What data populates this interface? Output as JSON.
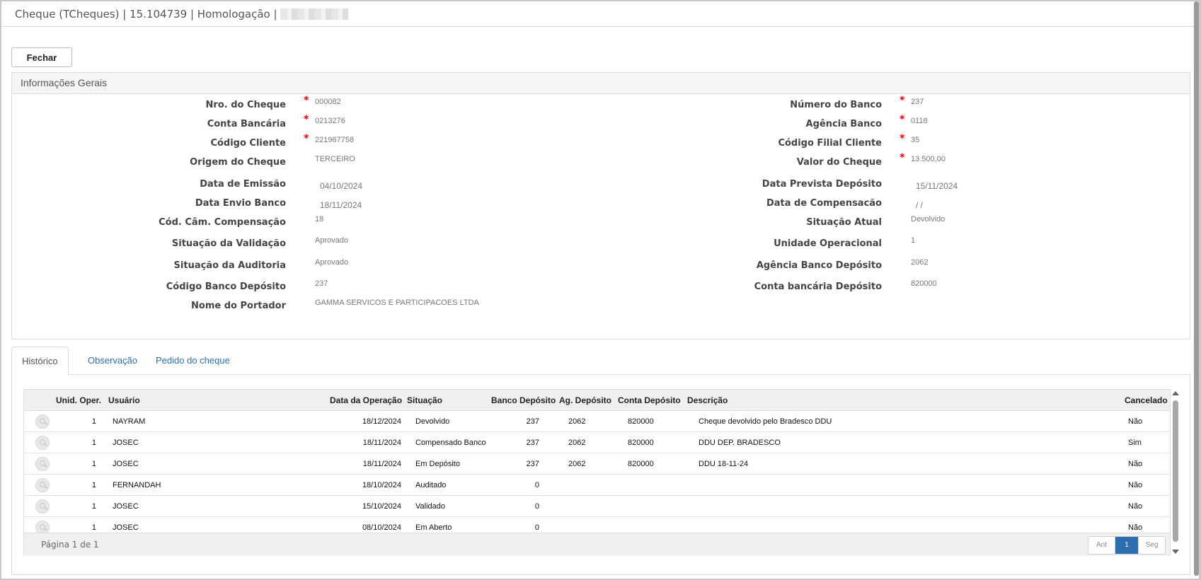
{
  "window": {
    "title": "Cheque (TCheques) | 15.104739 | Homologação |"
  },
  "toolbar": {
    "close_label": "Fechar"
  },
  "general": {
    "title": "Informações Gerais",
    "left": [
      {
        "label": "Nro. do Cheque",
        "value": "000082",
        "required": true
      },
      {
        "label": "Conta Bancária",
        "value": "0213276",
        "required": true
      },
      {
        "label": "Código Cliente",
        "value": "221967758",
        "required": true
      },
      {
        "label": "Origem do Cheque",
        "value": "TERCEIRO",
        "required": false
      },
      {
        "label": "Data de Emissão",
        "value": "04/10/2024",
        "required": false
      },
      {
        "label": "Data Envio Banco",
        "value": "18/11/2024",
        "required": false
      },
      {
        "label": "Cód. Câm. Compensação",
        "value": "18",
        "required": false
      },
      {
        "label": "Situação da Validação",
        "value": "Aprovado",
        "required": false
      },
      {
        "label": "Situação da Auditoria",
        "value": "Aprovado",
        "required": false
      },
      {
        "label": "Código Banco Depósito",
        "value": "237",
        "required": false
      },
      {
        "label": "Nome do Portador",
        "value": "GAMMA SERVICOS E PARTICIPACOES LTDA",
        "required": false
      }
    ],
    "right": [
      {
        "label": "Número do Banco",
        "value": "237",
        "required": true
      },
      {
        "label": "Agência Banco",
        "value": "0118",
        "required": true
      },
      {
        "label": "Código Filial Cliente",
        "value": "35",
        "required": true
      },
      {
        "label": "Valor do Cheque",
        "value": "13.500,00",
        "required": true
      },
      {
        "label": "Data Prevista Depósito",
        "value": "15/11/2024",
        "required": false
      },
      {
        "label": "Data de Compensacão",
        "value": "/ /",
        "required": false
      },
      {
        "label": "Situação Atual",
        "value": "Devolvido",
        "required": false
      },
      {
        "label": "Unidade Operacional",
        "value": "1",
        "required": false
      },
      {
        "label": "Agência Banco Depósito",
        "value": "2062",
        "required": false
      },
      {
        "label": "Conta bancária Depósito",
        "value": "820000",
        "required": false
      }
    ]
  },
  "tabs": [
    {
      "label": "Histórico",
      "active": true
    },
    {
      "label": "Observação",
      "active": false
    },
    {
      "label": "Pedido do cheque",
      "active": false
    }
  ],
  "history": {
    "columns": [
      "Unid. Oper.",
      "Usuário",
      "Data da Operação",
      "Situação",
      "Banco Depósito",
      "Ag. Depósito",
      "Conta Depósito",
      "Descrição",
      "Cancelado"
    ],
    "rows": [
      {
        "unid": "1",
        "usuario": "NAYRAM",
        "data": "18/12/2024",
        "situacao": "Devolvido",
        "banco": "237",
        "agencia": "2062",
        "conta": "820000",
        "descricao": "Cheque devolvido pelo Bradesco DDU",
        "cancelado": "Não"
      },
      {
        "unid": "1",
        "usuario": "JOSEC",
        "data": "18/11/2024",
        "situacao": "Compensado Banco",
        "banco": "237",
        "agencia": "2062",
        "conta": "820000",
        "descricao": "DDU DEP. BRADESCO",
        "cancelado": "Sim"
      },
      {
        "unid": "1",
        "usuario": "JOSEC",
        "data": "18/11/2024",
        "situacao": "Em Depósito",
        "banco": "237",
        "agencia": "2062",
        "conta": "820000",
        "descricao": "DDU 18-11-24",
        "cancelado": "Não"
      },
      {
        "unid": "1",
        "usuario": "FERNANDAH",
        "data": "18/10/2024",
        "situacao": "Auditado",
        "banco": "0",
        "agencia": "",
        "conta": "",
        "descricao": "",
        "cancelado": "Não"
      },
      {
        "unid": "1",
        "usuario": "JOSEC",
        "data": "15/10/2024",
        "situacao": "Validado",
        "banco": "0",
        "agencia": "",
        "conta": "",
        "descricao": "",
        "cancelado": "Não"
      },
      {
        "unid": "1",
        "usuario": "JOSEC",
        "data": "08/10/2024",
        "situacao": "Em Aberto",
        "banco": "0",
        "agencia": "",
        "conta": "",
        "descricao": "",
        "cancelado": "Não"
      }
    ],
    "page_info": "Página 1 de 1",
    "pager": {
      "prev": "Ant",
      "current": "1",
      "next": "Seg"
    }
  }
}
